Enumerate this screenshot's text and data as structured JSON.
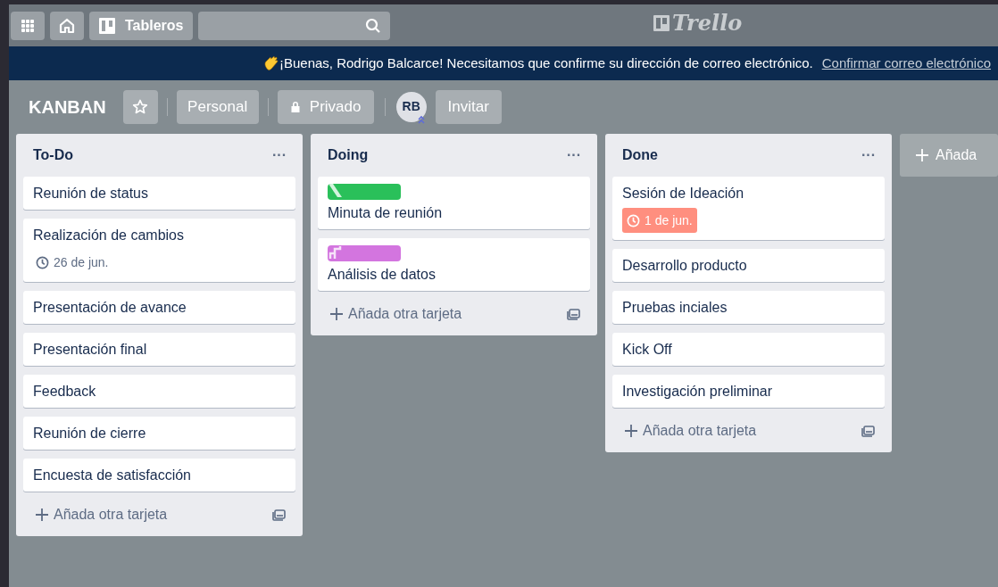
{
  "header": {
    "boards_button": "Tableros",
    "logo": "Trello"
  },
  "banner": {
    "message": "¡Buenas, Rodrigo Balcarce! Necesitamos que confirme su dirección de correo electrónico.",
    "link": "Confirmar correo electrónico"
  },
  "board": {
    "title": "KANBAN",
    "starred": false,
    "team_button": "Personal",
    "visibility_button": "Privado",
    "member_initials": "RB",
    "invite_button": "Invitar"
  },
  "lists": [
    {
      "title": "To-Do",
      "menu": "···",
      "cards": [
        {
          "title": "Reunión de status"
        },
        {
          "title": "Realización de cambios",
          "due": {
            "text": "26 de jun.",
            "overdue": false
          }
        },
        {
          "title": "Presentación de avance"
        },
        {
          "title": "Presentación final"
        },
        {
          "title": "Feedback"
        },
        {
          "title": "Reunión de cierre"
        },
        {
          "title": "Encuesta de satisfacción"
        }
      ],
      "add_card": "Añada otra tarjeta"
    },
    {
      "title": "Doing",
      "menu": "···",
      "cards": [
        {
          "title": "Minuta de reunión",
          "label": {
            "color": "#2ac05a",
            "kind": "stripe"
          }
        },
        {
          "title": "Análisis de datos",
          "label": {
            "color": "#d375df",
            "kind": "wave"
          }
        }
      ],
      "add_card": "Añada otra tarjeta"
    },
    {
      "title": "Done",
      "menu": "···",
      "cards": [
        {
          "title": "Sesión de Ideación",
          "due": {
            "text": "1 de jun.",
            "overdue": true
          }
        },
        {
          "title": "Desarrollo producto"
        },
        {
          "title": "Pruebas inciales"
        },
        {
          "title": "Kick Off"
        },
        {
          "title": "Investigación preliminar"
        }
      ],
      "add_card": "Añada otra tarjeta"
    }
  ],
  "add_list": "Añada"
}
